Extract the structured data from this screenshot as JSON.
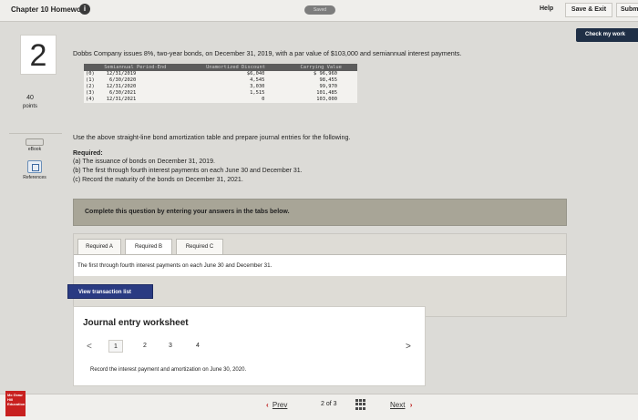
{
  "header": {
    "chapter_title": "Chapter 10 Homework",
    "saved_label": "Saved",
    "help_label": "Help",
    "save_exit_label": "Save & Exit",
    "submit_label": "Submit"
  },
  "check_work_label": "Check my work",
  "question": {
    "number": "2",
    "points_value": "40",
    "points_label": "points"
  },
  "sidebar": {
    "ebook_label": "eBook",
    "references_label": "References"
  },
  "prompt": "Dobbs Company issues 8%, two-year bonds, on December 31, 2019, with a par value of $103,000 and semiannual interest payments.",
  "table": {
    "headers": [
      "Semiannual Period-End",
      "Unamortized Discount",
      "Carrying Value"
    ],
    "rows": [
      {
        "period": "(0)",
        "date": "12/31/2019",
        "discount": "$6,040",
        "carrying": "$ 96,960"
      },
      {
        "period": "(1)",
        "date": "6/30/2020",
        "discount": "4,545",
        "carrying": "98,455"
      },
      {
        "period": "(2)",
        "date": "12/31/2020",
        "discount": "3,030",
        "carrying": "99,970"
      },
      {
        "period": "(3)",
        "date": "6/30/2021",
        "discount": "1,515",
        "carrying": "101,485"
      },
      {
        "period": "(4)",
        "date": "12/31/2021",
        "discount": "0",
        "carrying": "103,000"
      }
    ]
  },
  "instruction": "Use the above straight-line bond amortization table and prepare journal entries for the following.",
  "required": {
    "heading": "Required:",
    "a": "(a) The issuance of bonds on December 31, 2019.",
    "b": "(b) The first through fourth interest payments on each June 30 and December 31.",
    "c": "(c) Record the maturity of the bonds on December 31, 2021."
  },
  "complete_banner": "Complete this question by entering your answers in the tabs below.",
  "tabs": [
    {
      "label": "Required A"
    },
    {
      "label": "Required B"
    },
    {
      "label": "Required C"
    }
  ],
  "tab_description": "The first through fourth interest payments on each June 30 and December 31.",
  "view_transaction_label": "View transaction list",
  "worksheet": {
    "title": "Journal entry worksheet",
    "prev": "<",
    "next": ">",
    "pages": [
      "1",
      "2",
      "3",
      "4"
    ],
    "description": "Record the interest payment and amortization on June 30, 2020."
  },
  "footer": {
    "logo_text": "Mc Graw Hill Education",
    "prev_label": "Prev",
    "page_current": "2",
    "page_of": "of",
    "page_total": "3",
    "next_label": "Next"
  }
}
